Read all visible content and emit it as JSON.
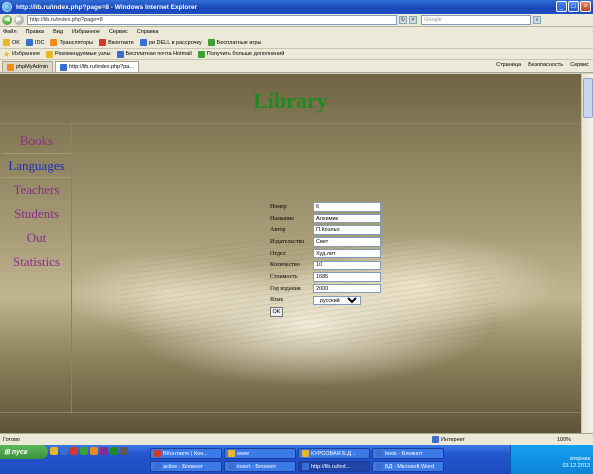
{
  "window": {
    "title": "http://lib.ru/index.php?page=8 - Windows Internet Explorer",
    "minimize": "_",
    "maximize": "□",
    "close": "×"
  },
  "address": {
    "url": "http://lib.ru/index.php?page=8",
    "search_placeholder": "Google"
  },
  "menu": [
    "Файл",
    "Правка",
    "Вид",
    "Избранное",
    "Сервис",
    "Справка"
  ],
  "toolbar1": [
    {
      "icon": "yellow",
      "label": "OK"
    },
    {
      "icon": "blue",
      "label": "IDC"
    },
    {
      "icon": "orange",
      "label": "Трансляторы"
    },
    {
      "icon": "red",
      "label": "Вконтакте"
    },
    {
      "icon": "blue",
      "label": "ри DELL в рассрочку"
    },
    {
      "icon": "green",
      "label": "Бесплатные игры"
    }
  ],
  "toolbar2": [
    {
      "icon": "star",
      "label": "Избранное"
    },
    {
      "icon": "yellow",
      "label": "Рекомендуемые узлы"
    },
    {
      "icon": "blue",
      "label": "Бесплатная почта Hotmail"
    },
    {
      "icon": "green",
      "label": "Получить больше дополнений"
    }
  ],
  "tabs": [
    {
      "label": "phpMyAdmin"
    },
    {
      "label": "http://lib.ru/index.php?pa..."
    }
  ],
  "tab_tools": [
    "Страница",
    "Безопасность",
    "Сервис"
  ],
  "page": {
    "title": "Library",
    "nav": [
      {
        "label": "Books",
        "color": "#8a2a8a"
      },
      {
        "label": "Languages",
        "color": "#1f2fb8"
      },
      {
        "label": "Teachers",
        "color": "#8a2a8a"
      },
      {
        "label": "Students",
        "color": "#8a2a8a"
      },
      {
        "label": "Out",
        "color": "#8a2a8a"
      },
      {
        "label": "Statistics",
        "color": "#8a2a8a"
      }
    ],
    "form": {
      "fields": [
        {
          "label": "Номер",
          "value": "6"
        },
        {
          "label": "Название",
          "value": "Алхимик"
        },
        {
          "label": "Автор",
          "value": "П.Коэльо"
        },
        {
          "label": "Издательство",
          "value": "Свет"
        },
        {
          "label": "Отдел",
          "value": "Худ.лит"
        },
        {
          "label": "Количество",
          "value": "10"
        },
        {
          "label": "Стоимость",
          "value": "1685"
        },
        {
          "label": "Год издания",
          "value": "2000"
        }
      ],
      "language": {
        "label": "Язык",
        "selected": "русский"
      },
      "submit": "OK"
    }
  },
  "status": {
    "left": "Готово",
    "zone": "Интернет",
    "zoom": "100%"
  },
  "taskbar": {
    "start": "пуск",
    "buttons": [
      {
        "label": "ВКонтакте | Кон..."
      },
      {
        "label": "www"
      },
      {
        "label": "КУРСОВАЯ Б.Д..."
      },
      {
        "label": "book - Блокнот"
      },
      {
        "label": "active - Блокнот"
      },
      {
        "label": "insert - Блокнот"
      },
      {
        "label": "http://lib.ru/ind..."
      },
      {
        "label": "БД - Microsoft Word"
      }
    ],
    "day": "вторник",
    "time": "03.12.2013"
  }
}
